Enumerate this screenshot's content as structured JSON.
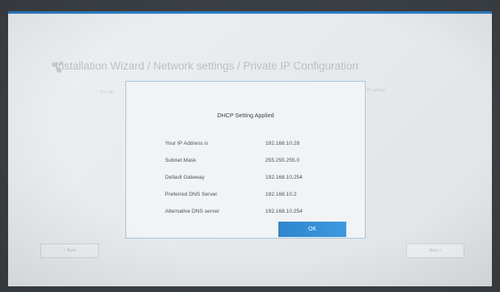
{
  "wizard": {
    "title": "Installation Wizard / Network settings / Private IP Configuration",
    "behind_text_left": "You can",
    "behind_text_right": "IP settings",
    "back_label": "< Back",
    "next_label": "Next >"
  },
  "dialog": {
    "title": "DHCP Setting Applied",
    "rows": [
      {
        "label": "Your IP Address is",
        "value": "192.168.10.28"
      },
      {
        "label": "Subnet Mask",
        "value": "255.255.255.0"
      },
      {
        "label": "Default Gateway",
        "value": "192.168.10.254"
      },
      {
        "label": "Preferred DNS Server",
        "value": "192.168.10.2"
      },
      {
        "label": "Alternative DNS server",
        "value": "192.168.10.254"
      }
    ],
    "ok_label": "OK"
  },
  "colors": {
    "accent": "#2f86cf",
    "frame": "#2d7fc3"
  },
  "icons": {
    "logo": "network-logo-icon"
  }
}
